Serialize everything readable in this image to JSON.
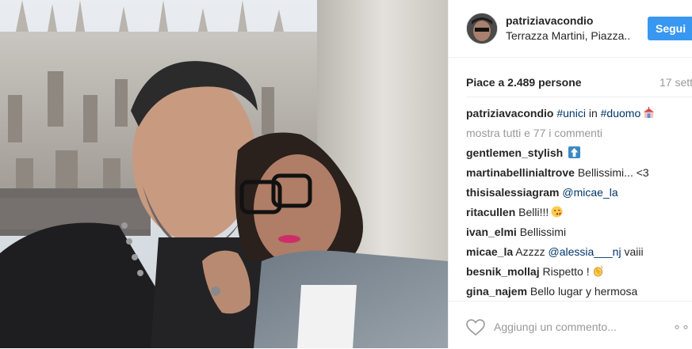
{
  "post": {
    "username": "patriziavacondio",
    "location": "Terrazza Martini, Piazza..",
    "follow_label": "Segui",
    "likes": "Piace a 2.489 persone",
    "date": "17 sett"
  },
  "caption": {
    "user": "patriziavacondio",
    "tag1": "#unici",
    "mid": " in ",
    "tag2": "#duomo"
  },
  "show_all": "mostra tutti e 77 i commenti",
  "comments": [
    {
      "user": "gentlemen_stylish",
      "text": "",
      "emoji": "top-arrow-emoji"
    },
    {
      "user": "martinabellinialtrove",
      "text": "Bellissimi... <3"
    },
    {
      "user": "thisisalessiagram",
      "mention": "@micae_la",
      "text": ""
    },
    {
      "user": "ritacullen",
      "text": "Belli!!!",
      "emoji": "kiss-face-emoji"
    },
    {
      "user": "ivan_elmi",
      "text": "Bellissimi"
    },
    {
      "user": "micae_la",
      "text": "Azzzz",
      "mention": "@alessia___nj",
      "text2": "vaiii"
    },
    {
      "user": "besnik_mollaj",
      "text": "Rispetto !",
      "emoji": "clap-emoji"
    },
    {
      "user": "gina_najem",
      "text": "Bello lugar y hermosa"
    }
  ],
  "add_comment_placeholder": "Aggiungi un commento...",
  "options_label": "∘∘∘",
  "colors": {
    "accent": "#3897f0",
    "tag": "#003569",
    "muted": "#999999"
  }
}
